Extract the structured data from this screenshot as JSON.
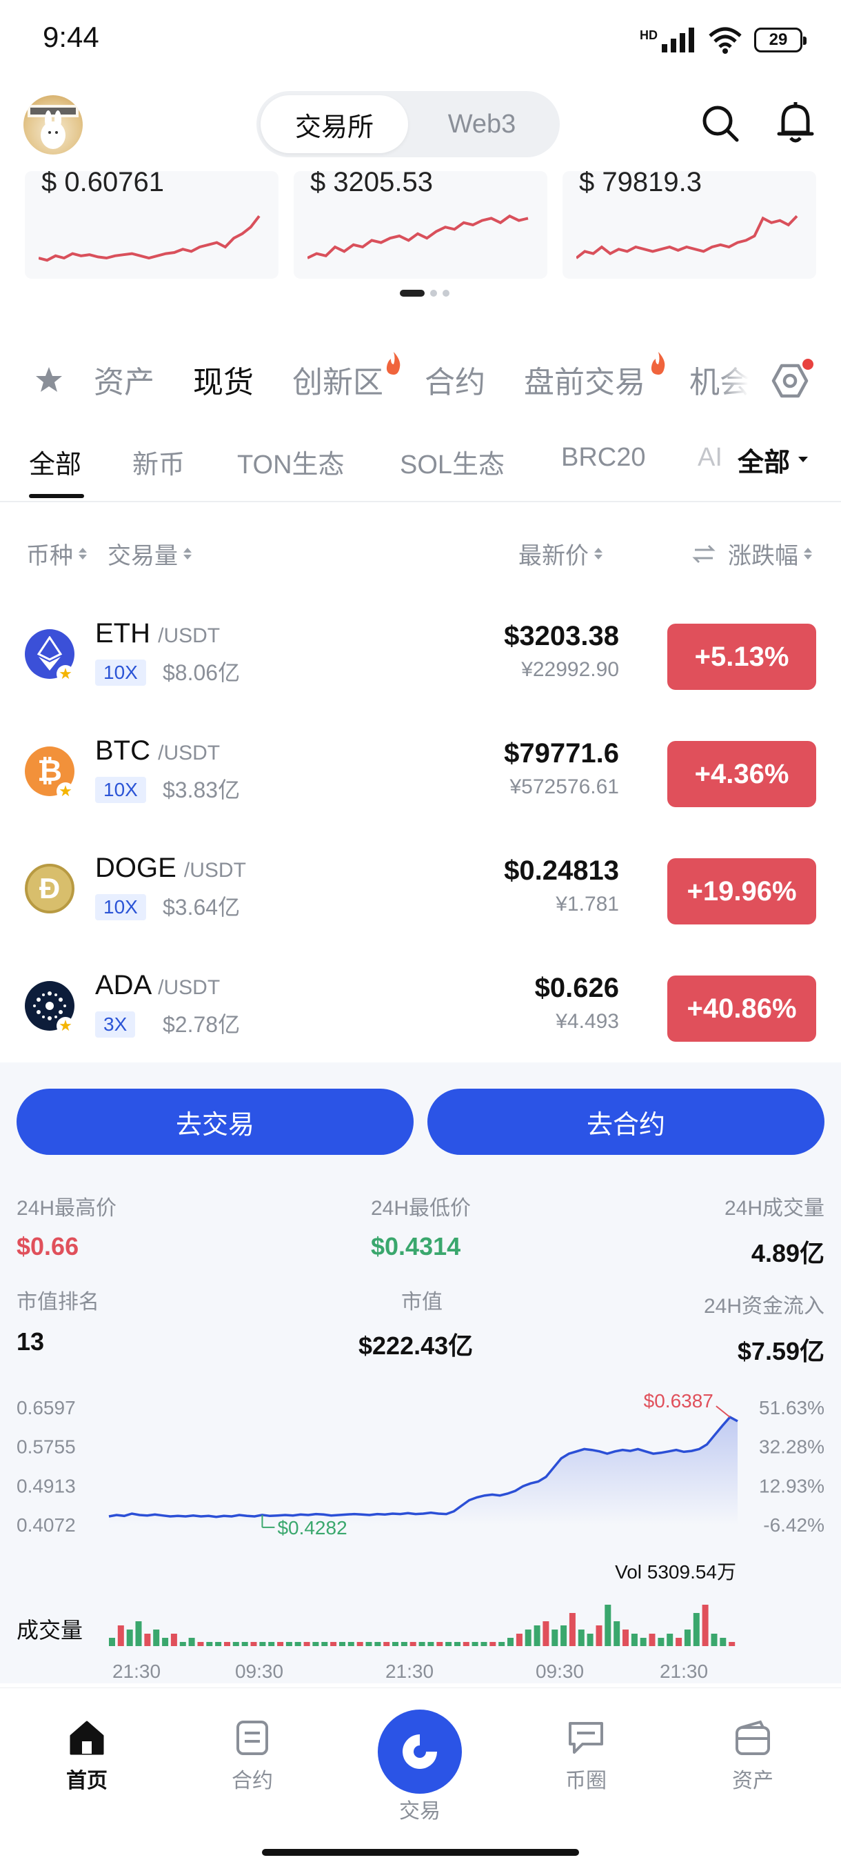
{
  "status": {
    "time": "9:44",
    "battery": "29",
    "network": "HD"
  },
  "header": {
    "tabs": [
      {
        "label": "交易所",
        "active": true
      },
      {
        "label": "Web3",
        "active": false
      }
    ]
  },
  "mini_cards": [
    {
      "price": "$ 0.60761",
      "spark": [
        40,
        42,
        38,
        40,
        36,
        38,
        37,
        39,
        40,
        38,
        37,
        36,
        38,
        40,
        38,
        36,
        35,
        32,
        34,
        30,
        28,
        26,
        30,
        22,
        18,
        12,
        2
      ]
    },
    {
      "price": "$ 3205.53",
      "spark": [
        40,
        36,
        38,
        30,
        34,
        28,
        30,
        24,
        26,
        22,
        20,
        24,
        18,
        22,
        16,
        12,
        14,
        8,
        10,
        6,
        4,
        8,
        2,
        6,
        4
      ]
    },
    {
      "price": "$ 79819.3",
      "spark": [
        40,
        34,
        36,
        30,
        36,
        32,
        34,
        30,
        32,
        34,
        32,
        30,
        33,
        30,
        32,
        34,
        30,
        28,
        30,
        26,
        24,
        20,
        4,
        8,
        6,
        10,
        2
      ]
    }
  ],
  "nav_main": [
    {
      "label": "资产",
      "active": false
    },
    {
      "label": "现货",
      "active": true
    },
    {
      "label": "创新区",
      "active": false,
      "hot": true
    },
    {
      "label": "合约",
      "active": false
    },
    {
      "label": "盘前交易",
      "active": false,
      "hot": true
    },
    {
      "label": "机会",
      "active": false
    }
  ],
  "nav_sub": [
    {
      "label": "全部",
      "active": true
    },
    {
      "label": "新币"
    },
    {
      "label": "TON生态"
    },
    {
      "label": "SOL生态"
    },
    {
      "label": "BRC20"
    },
    {
      "label": "AI"
    }
  ],
  "nav_sub_filter": "全部",
  "columns": {
    "coin": "币种",
    "volume": "交易量",
    "price": "最新价",
    "change": "涨跌幅"
  },
  "rows": [
    {
      "symbol": "ETH",
      "pair": "/USDT",
      "leverage": "10X",
      "volume": "$8.06亿",
      "price": "$3203.38",
      "cny": "¥22992.90",
      "change": "+5.13%",
      "icon": "eth-icon",
      "color": "#3b50d8"
    },
    {
      "symbol": "BTC",
      "pair": "/USDT",
      "leverage": "10X",
      "volume": "$3.83亿",
      "price": "$79771.6",
      "cny": "¥572576.61",
      "change": "+4.36%",
      "icon": "btc-icon",
      "color": "#f2913a"
    },
    {
      "symbol": "DOGE",
      "pair": "/USDT",
      "leverage": "10X",
      "volume": "$3.64亿",
      "price": "$0.24813",
      "cny": "¥1.781",
      "change": "+19.96%",
      "icon": "doge-icon",
      "color": "#c9a74a"
    },
    {
      "symbol": "ADA",
      "pair": "/USDT",
      "leverage": "3X",
      "volume": "$2.78亿",
      "price": "$0.626",
      "cny": "¥4.493",
      "change": "+40.86%",
      "icon": "ada-icon",
      "color": "#0d1d3a"
    }
  ],
  "actions": {
    "trade": "去交易",
    "contract": "去合约"
  },
  "stats": {
    "high_label": "24H最高价",
    "high": "$0.66",
    "low_label": "24H最低价",
    "low": "$0.4314",
    "vol_label": "24H成交量",
    "vol": "4.89亿",
    "rank_label": "市值排名",
    "rank": "13",
    "mcap_label": "市值",
    "mcap": "$222.43亿",
    "inflow_label": "24H资金流入",
    "inflow": "$7.59亿"
  },
  "chart_data": {
    "type": "area",
    "y_ticks": [
      "0.6597",
      "0.5755",
      "0.4913",
      "0.4072"
    ],
    "pct_ticks": [
      "51.63%",
      "32.28%",
      "12.93%",
      "-6.42%"
    ],
    "ylim": [
      0.4072,
      0.6597
    ],
    "high_label": "$0.6387",
    "low_label": "$0.4282",
    "x_ticks": [
      "21:30",
      "09:30",
      "21:30",
      "09:30",
      "21:30"
    ],
    "price_series": [
      0.425,
      0.428,
      0.426,
      0.431,
      0.428,
      0.427,
      0.429,
      0.427,
      0.425,
      0.426,
      0.425,
      0.427,
      0.425,
      0.426,
      0.424,
      0.426,
      0.425,
      0.428,
      0.426,
      0.425,
      0.4282,
      0.426,
      0.427,
      0.428,
      0.427,
      0.429,
      0.428,
      0.43,
      0.429,
      0.427,
      0.428,
      0.429,
      0.43,
      0.429,
      0.428,
      0.43,
      0.429,
      0.431,
      0.43,
      0.432,
      0.43,
      0.431,
      0.433,
      0.431,
      0.43,
      0.436,
      0.448,
      0.46,
      0.466,
      0.47,
      0.472,
      0.47,
      0.474,
      0.48,
      0.49,
      0.496,
      0.5,
      0.51,
      0.53,
      0.55,
      0.56,
      0.565,
      0.57,
      0.568,
      0.565,
      0.56,
      0.565,
      0.568,
      0.566,
      0.57,
      0.565,
      0.56,
      0.562,
      0.565,
      0.568,
      0.564,
      0.566,
      0.57,
      0.58,
      0.6,
      0.62,
      0.6387,
      0.63
    ],
    "volume_label": "成交量",
    "vol_total": "Vol 5309.54万",
    "volumes": [
      2,
      5,
      4,
      6,
      3,
      4,
      2,
      3,
      1,
      2,
      1,
      1,
      1,
      1,
      1,
      1,
      1,
      1,
      1,
      1,
      1,
      1,
      1,
      1,
      1,
      1,
      1,
      1,
      1,
      1,
      1,
      1,
      1,
      1,
      1,
      1,
      1,
      1,
      1,
      1,
      1,
      1,
      1,
      1,
      1,
      2,
      3,
      4,
      5,
      6,
      4,
      5,
      8,
      4,
      3,
      5,
      10,
      6,
      4,
      3,
      2,
      3,
      2,
      3,
      2,
      4,
      8,
      10,
      3,
      2,
      1
    ]
  },
  "tabbar": [
    {
      "label": "首页",
      "active": true,
      "icon": "home-icon"
    },
    {
      "label": "合约",
      "icon": "contract-icon"
    },
    {
      "label": "交易",
      "icon": "trade-icon"
    },
    {
      "label": "币圈",
      "icon": "chat-icon"
    },
    {
      "label": "资产",
      "icon": "wallet-icon"
    }
  ]
}
